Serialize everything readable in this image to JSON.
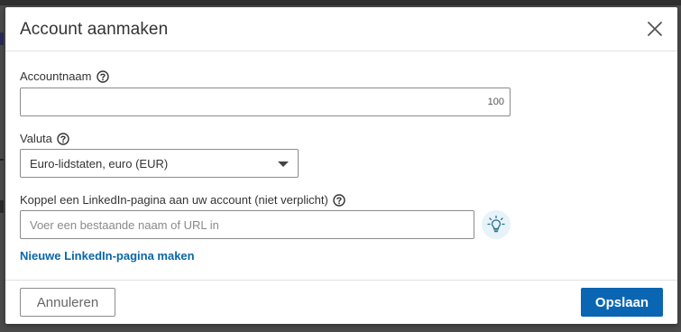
{
  "dialog": {
    "title": "Account aanmaken",
    "close_icon": "close-icon"
  },
  "form": {
    "account_name": {
      "label": "Accountnaam",
      "value": "",
      "char_limit": "100",
      "help_icon": "help-icon"
    },
    "currency": {
      "label": "Valuta",
      "selected": "Euro-lidstaten, euro (EUR)",
      "help_icon": "help-icon"
    },
    "linkedin_page": {
      "label": "Koppel een LinkedIn-pagina aan uw account (niet verplicht)",
      "placeholder": "Voer een bestaande naam of URL in",
      "help_icon": "help-icon",
      "tip_icon": "lightbulb-icon"
    },
    "new_page_link": "Nieuwe LinkedIn-pagina maken"
  },
  "footer": {
    "cancel_label": "Annuleren",
    "save_label": "Opslaan"
  },
  "colors": {
    "primary": "#0a66b2",
    "link": "#0a66a8",
    "backdrop": "#4a4a4a",
    "tip_background": "#e6f3f9"
  }
}
